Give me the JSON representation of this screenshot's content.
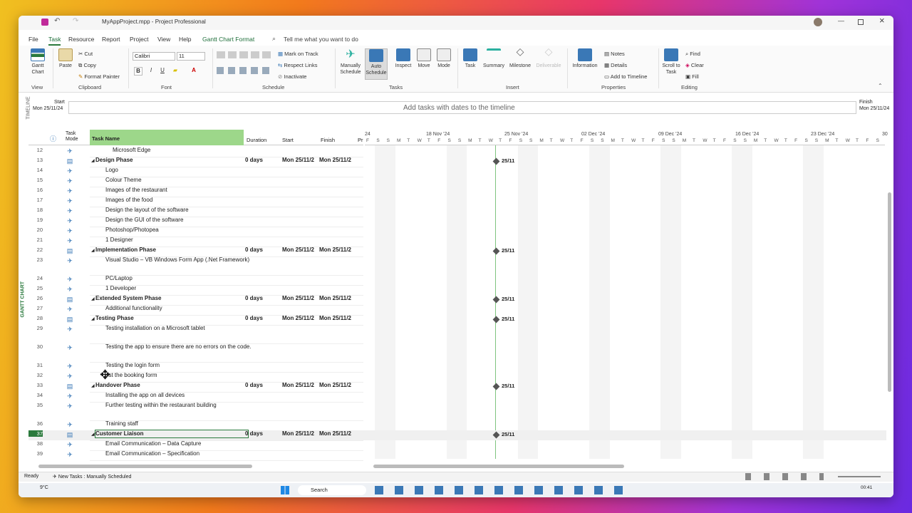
{
  "titlebar": {
    "title": "MyAppProject.mpp  -  Project Professional"
  },
  "ribbon": {
    "tabs": [
      "File",
      "Task",
      "Resource",
      "Report",
      "Project",
      "View",
      "Help",
      "Gantt Chart Format"
    ],
    "search_placeholder": "Tell me what you want to do",
    "groups": {
      "view": "View",
      "clipboard": "Clipboard",
      "font": "Font",
      "schedule": "Schedule",
      "tasks": "Tasks",
      "insert": "Insert",
      "properties": "Properties",
      "editing": "Editing"
    },
    "view": {
      "gantt": "Gantt Chart"
    },
    "clipboard": {
      "paste": "Paste",
      "cut": "Cut",
      "copy": "Copy",
      "format_painter": "Format Painter"
    },
    "font": {
      "family": "Calibri",
      "size": "11",
      "bold": "B",
      "italic": "I",
      "underline": "U"
    },
    "schedule": {
      "mark_on_track": "Mark on Track",
      "respect_links": "Respect Links",
      "inactivate": "Inactivate"
    },
    "tasks": {
      "manually": "Manually Schedule",
      "auto": "Auto Schedule",
      "inspect": "Inspect",
      "move": "Move",
      "mode": "Mode"
    },
    "insert": {
      "task": "Task",
      "summary": "Summary",
      "milestone": "Milestone",
      "deliverable": "Deliverable"
    },
    "properties": {
      "information": "Information",
      "notes": "Notes",
      "details": "Details",
      "add_to_timeline": "Add to Timeline"
    },
    "editing": {
      "scroll": "Scroll to Task",
      "find": "Find",
      "clear": "Clear",
      "fill": "Fill"
    }
  },
  "timeline": {
    "label": "TIMELINE",
    "start_label": "Start",
    "start_date": "Mon 25/11/24",
    "finish_label": "Finish",
    "finish_date": "Mon 25/11/24",
    "placeholder": "Add tasks with dates to the timeline"
  },
  "sideLabel": "GANTT CHART",
  "columns": {
    "mode": "Task Mode",
    "name": "Task Name",
    "duration": "Duration",
    "start": "Start",
    "finish": "Finish",
    "pred": "Pr"
  },
  "timescale": {
    "weeks": [
      "24",
      "18 Nov '24",
      "25 Nov '24",
      "02 Dec '24",
      "09 Dec '24",
      "16 Dec '24",
      "23 Dec '24",
      "30"
    ],
    "days": [
      "F",
      "S",
      "S",
      "M",
      "T",
      "W",
      "T",
      "F",
      "S",
      "S",
      "M",
      "T",
      "W",
      "T",
      "F",
      "S",
      "S",
      "M",
      "T",
      "W",
      "T",
      "F",
      "S",
      "S",
      "M",
      "T",
      "W",
      "T",
      "F",
      "S",
      "S",
      "M",
      "T",
      "W",
      "T",
      "F",
      "S",
      "S",
      "M",
      "T",
      "W",
      "T",
      "F",
      "S",
      "S",
      "M",
      "T",
      "W",
      "T",
      "F",
      "S"
    ]
  },
  "tasks": [
    {
      "id": "12",
      "name": "Microsoft Edge",
      "indent": 2,
      "summary": false,
      "duration": "",
      "start": "",
      "finish": ""
    },
    {
      "id": "13",
      "name": "Design Phase",
      "indent": 1,
      "summary": true,
      "duration": "0 days",
      "start": "Mon 25/11/2",
      "finish": "Mon 25/11/2",
      "ms": "25/11"
    },
    {
      "id": "14",
      "name": "Logo",
      "indent": 2,
      "summary": false
    },
    {
      "id": "15",
      "name": "Colour Theme",
      "indent": 2,
      "summary": false
    },
    {
      "id": "16",
      "name": "Images of the restaurant",
      "indent": 2,
      "summary": false
    },
    {
      "id": "17",
      "name": "Images of the food",
      "indent": 2,
      "summary": false
    },
    {
      "id": "18",
      "name": "Design the layout of the software",
      "indent": 2,
      "summary": false
    },
    {
      "id": "19",
      "name": "Design the GUI of the software",
      "indent": 2,
      "summary": false
    },
    {
      "id": "20",
      "name": "Photoshop/Photopea",
      "indent": 2,
      "summary": false
    },
    {
      "id": "21",
      "name": "1 Designer",
      "indent": 2,
      "summary": false
    },
    {
      "id": "22",
      "name": "Implementation Phase",
      "indent": 1,
      "summary": true,
      "duration": "0 days",
      "start": "Mon 25/11/2",
      "finish": "Mon 25/11/2",
      "ms": "25/11"
    },
    {
      "id": "23",
      "name": "Visual Studio – VB Windows Form App (.Net Framework)",
      "indent": 2,
      "summary": false,
      "tall": true
    },
    {
      "id": "24",
      "name": "PC/Laptop",
      "indent": 2,
      "summary": false
    },
    {
      "id": "25",
      "name": "1 Developer",
      "indent": 2,
      "summary": false
    },
    {
      "id": "26",
      "name": "Extended System Phase",
      "indent": 1,
      "summary": true,
      "duration": "0 days",
      "start": "Mon 25/11/2",
      "finish": "Mon 25/11/2",
      "ms": "25/11"
    },
    {
      "id": "27",
      "name": "Additional functionality",
      "indent": 2,
      "summary": false
    },
    {
      "id": "28",
      "name": "Testing Phase",
      "indent": 1,
      "summary": true,
      "duration": "0 days",
      "start": "Mon 25/11/2",
      "finish": "Mon 25/11/2",
      "ms": "25/11"
    },
    {
      "id": "29",
      "name": "Testing installation on a Microsoft tablet",
      "indent": 2,
      "summary": false,
      "tall": true
    },
    {
      "id": "30",
      "name": "Testing the app to ensure there are no errors on the code.",
      "indent": 2,
      "summary": false,
      "tall": true
    },
    {
      "id": "31",
      "name": "Testing the login form",
      "indent": 2,
      "summary": false
    },
    {
      "id": "32",
      "name": "est the booking form",
      "indent": 2,
      "summary": false
    },
    {
      "id": "33",
      "name": "Handover Phase",
      "indent": 1,
      "summary": true,
      "duration": "0 days",
      "start": "Mon 25/11/2",
      "finish": "Mon 25/11/2",
      "ms": "25/11"
    },
    {
      "id": "34",
      "name": "Installing the app on all devices",
      "indent": 2,
      "summary": false
    },
    {
      "id": "35",
      "name": "Further testing within the restaurant building",
      "indent": 2,
      "summary": false,
      "tall": true
    },
    {
      "id": "36",
      "name": "Training staff",
      "indent": 2,
      "summary": false
    },
    {
      "id": "37",
      "name": "Customer Liaison",
      "indent": 1,
      "summary": true,
      "duration": "0 days",
      "start": "Mon 25/11/2",
      "finish": "Mon 25/11/2",
      "ms": "25/11",
      "selected": true
    },
    {
      "id": "38",
      "name": "Email Communication – Data Capture",
      "indent": 2,
      "summary": false
    },
    {
      "id": "39",
      "name": "Email Communication – Specification",
      "indent": 2,
      "summary": false
    }
  ],
  "status": {
    "ready": "Ready",
    "new_tasks": "New Tasks : Manually Scheduled"
  },
  "taskbar": {
    "weather": "9°C",
    "search": "Search",
    "time": "00:41"
  }
}
